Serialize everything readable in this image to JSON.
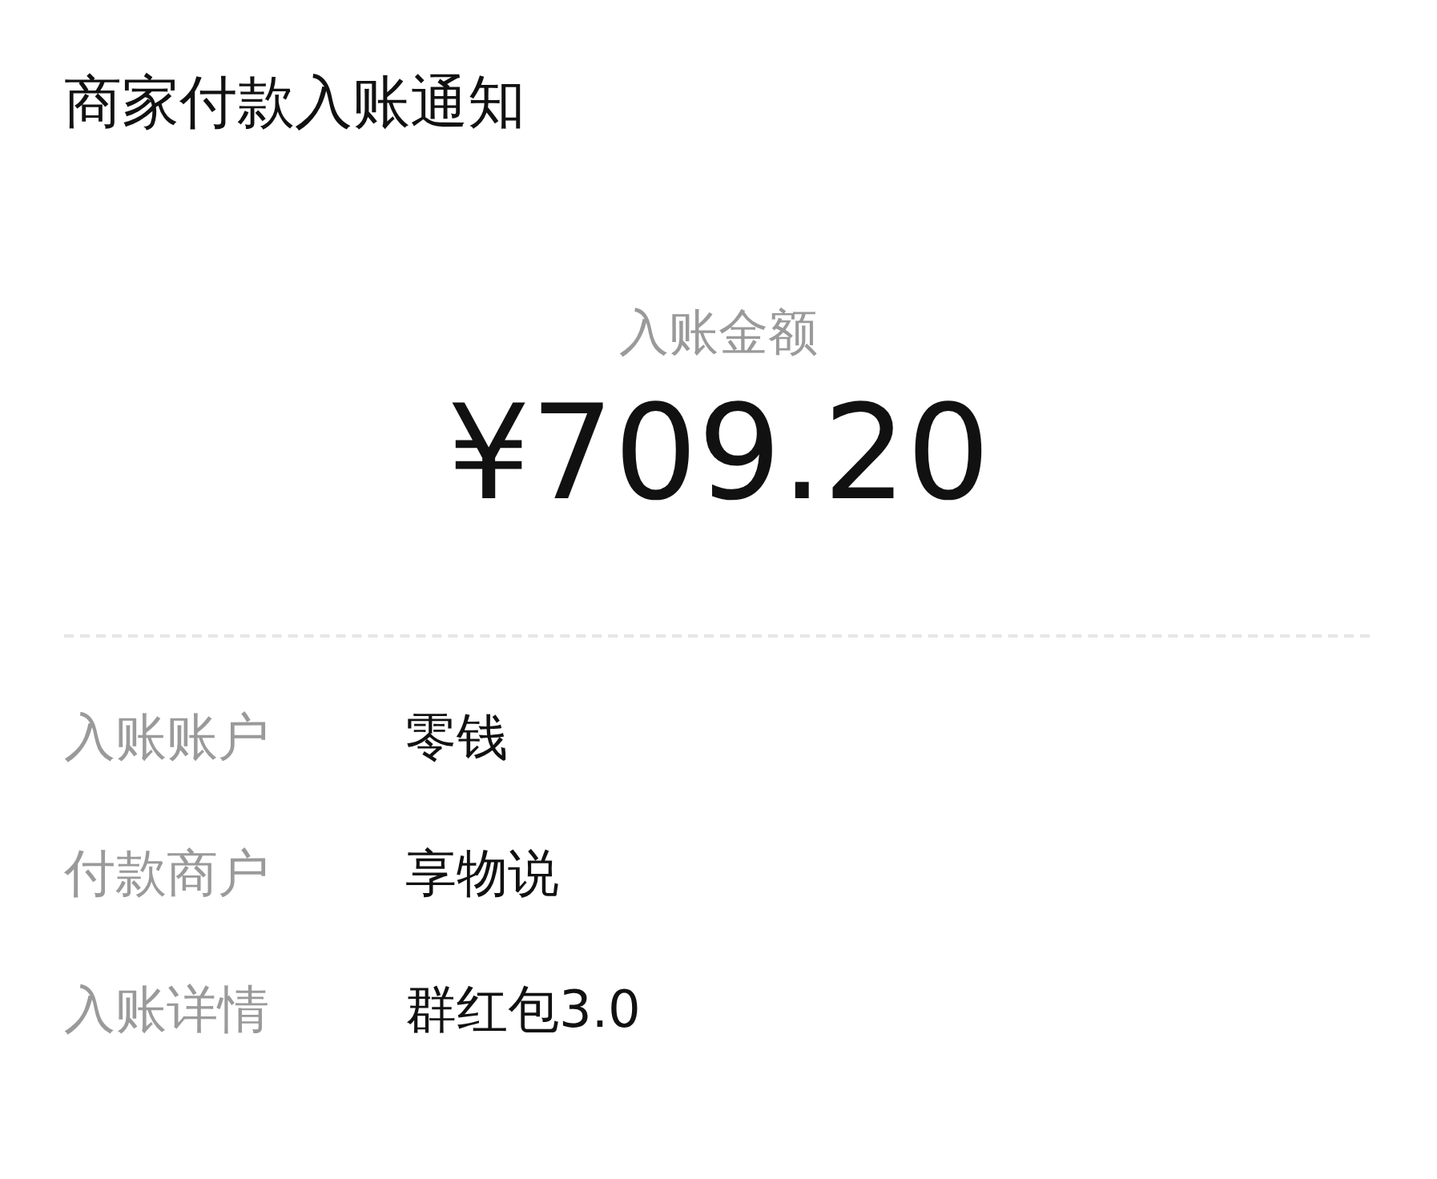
{
  "title": "商家付款入账通知",
  "amount": {
    "label": "入账金额",
    "value": "¥709.20"
  },
  "details": [
    {
      "label": "入账账户",
      "value": "零钱"
    },
    {
      "label": "付款商户",
      "value": "享物说"
    },
    {
      "label": "入账详情",
      "value": "群红包3.0"
    }
  ]
}
